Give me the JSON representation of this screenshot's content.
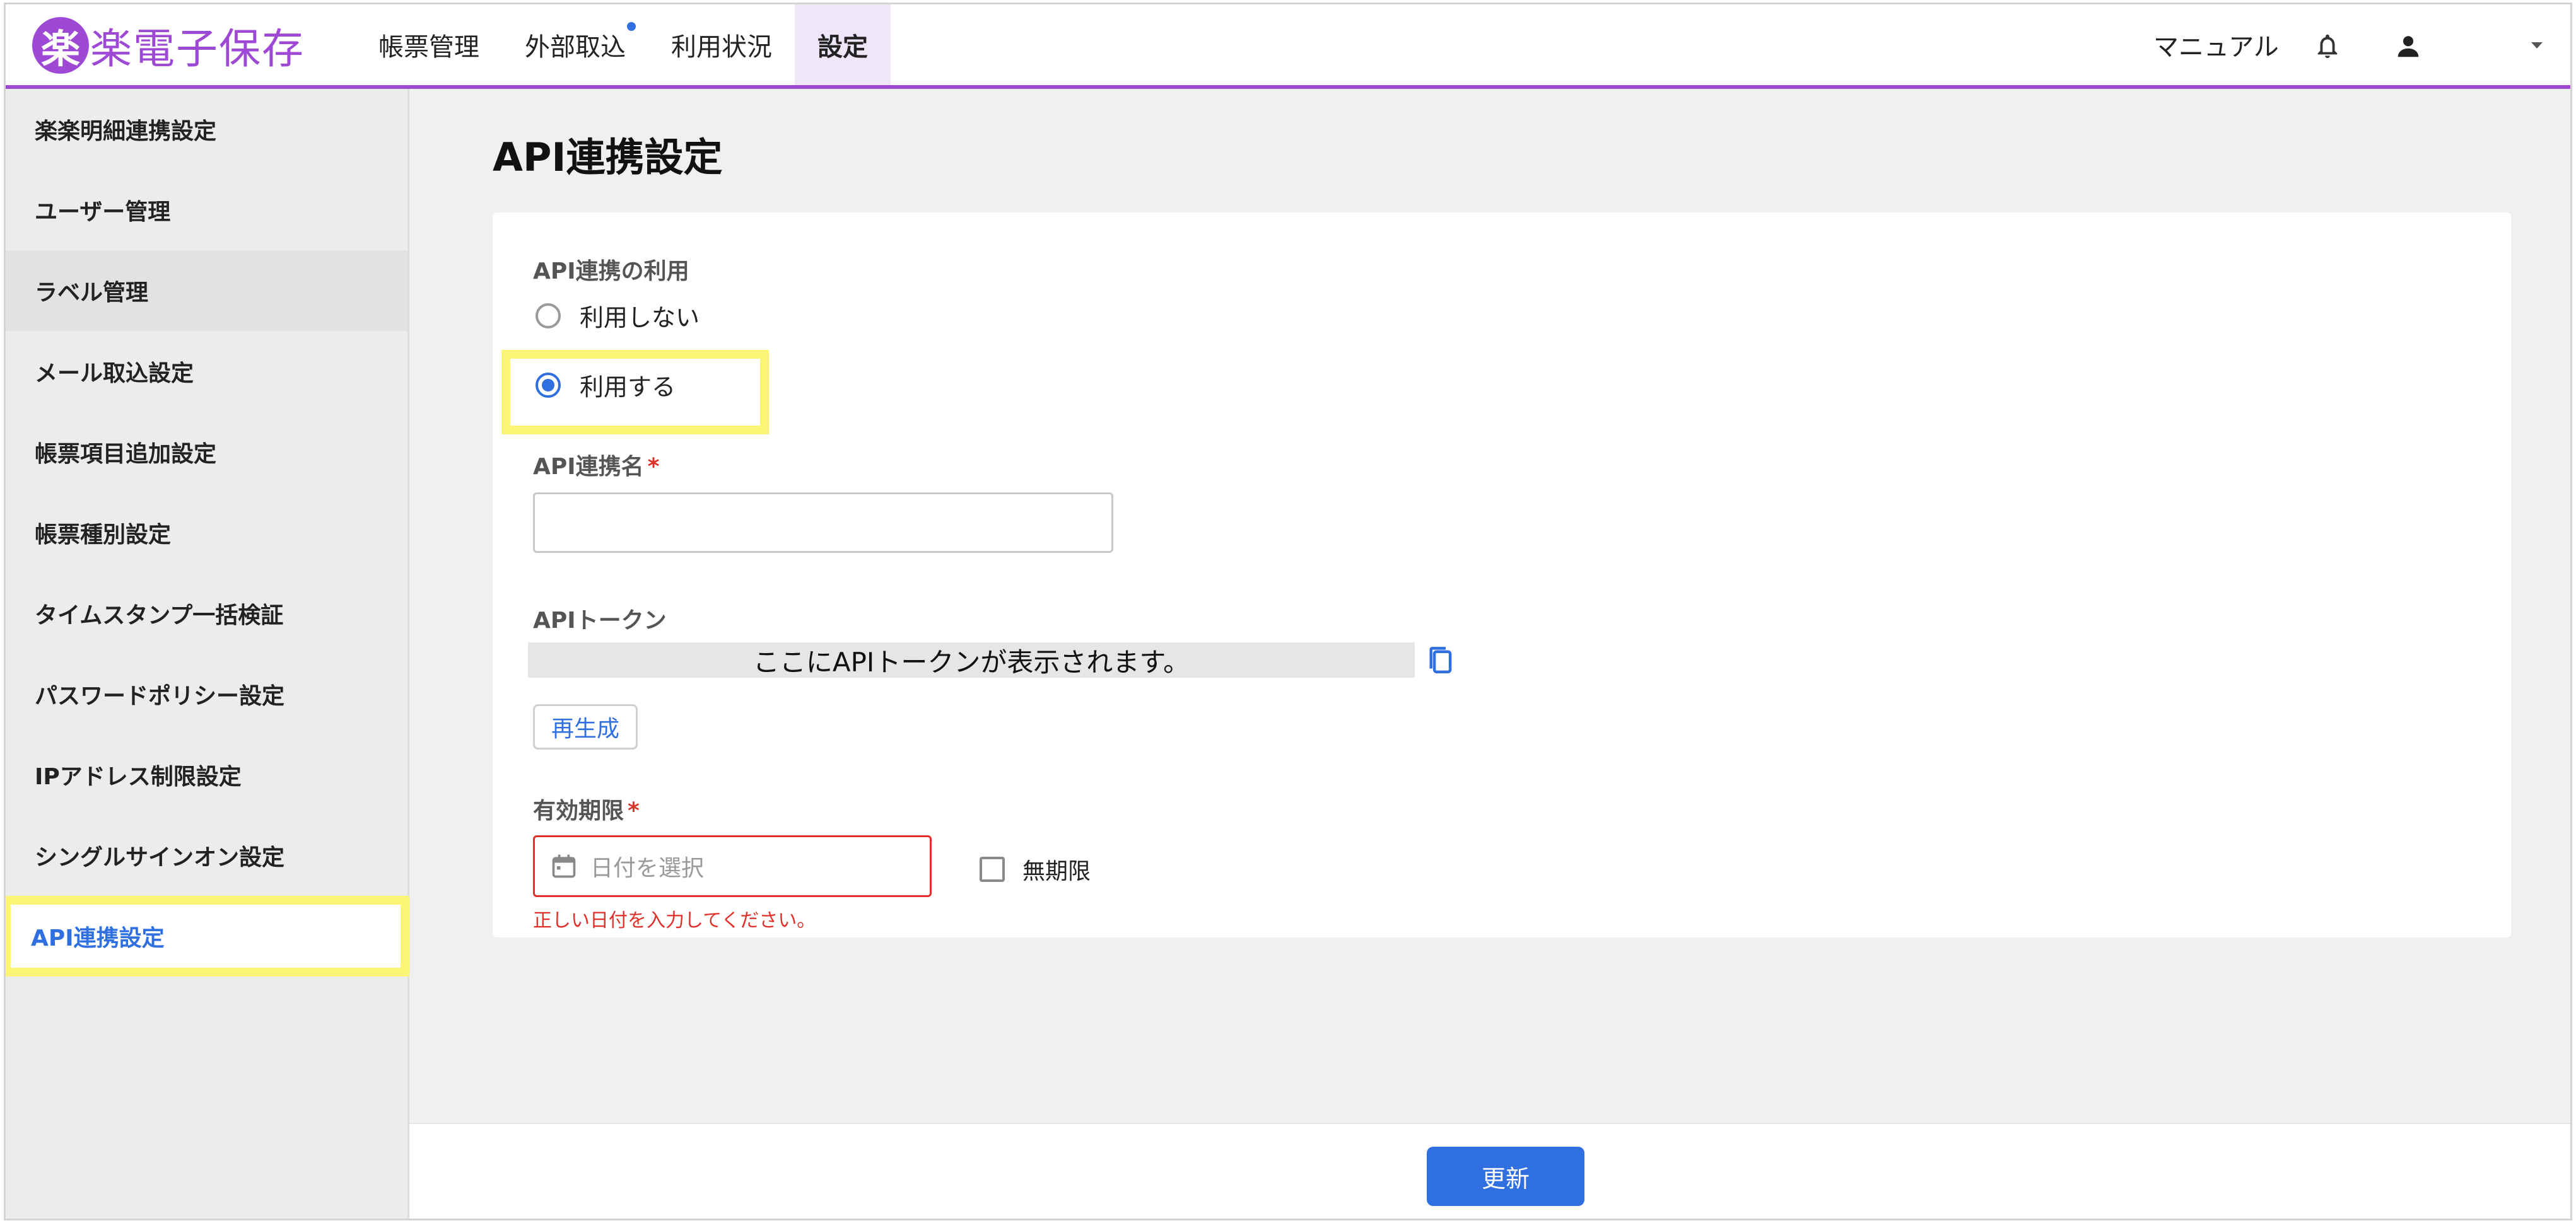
{
  "header": {
    "logo_mark": "楽",
    "logo_text": "楽電子保存",
    "nav": [
      {
        "label": "帳票管理"
      },
      {
        "label": "外部取込"
      },
      {
        "label": "利用状況"
      },
      {
        "label": "設定"
      }
    ],
    "manual_label": "マニュアル",
    "icons": [
      "bell-icon",
      "user-icon",
      "caret-down-icon"
    ],
    "accent_color": "#9d49d6"
  },
  "sidebar": {
    "items": [
      {
        "label": "楽楽明細連携設定"
      },
      {
        "label": "ユーザー管理"
      },
      {
        "label": "ラベル管理"
      },
      {
        "label": "メール取込設定"
      },
      {
        "label": "帳票項目追加設定"
      },
      {
        "label": "帳票種別設定"
      },
      {
        "label": "タイムスタンプ一括検証"
      },
      {
        "label": "パスワードポリシー設定"
      },
      {
        "label": "IPアドレス制限設定"
      },
      {
        "label": "シングルサインオン設定"
      },
      {
        "label": "API連携設定"
      }
    ],
    "active_label": "API連携設定"
  },
  "main": {
    "title": "API連携設定",
    "api_usage": {
      "label": "API連携の利用",
      "options": [
        {
          "label": "利用しない",
          "selected": false
        },
        {
          "label": "利用する",
          "selected": true
        }
      ]
    },
    "api_name": {
      "label": "API連携名",
      "required_mark": "*",
      "value": ""
    },
    "api_token": {
      "label": "APIトークン",
      "placeholder": "ここにAPIトークンが表示されます。",
      "regenerate_label": "再生成"
    },
    "expiry": {
      "label": "有効期限",
      "required_mark": "*",
      "placeholder": "日付を選択",
      "no_limit_label": "無期限",
      "no_limit_checked": false,
      "error": "正しい日付を入力してください。"
    }
  },
  "footer": {
    "update_label": "更新"
  },
  "colors": {
    "primary": "#2f6fe0",
    "error": "#e0302a",
    "highlight": "#fbf475"
  }
}
